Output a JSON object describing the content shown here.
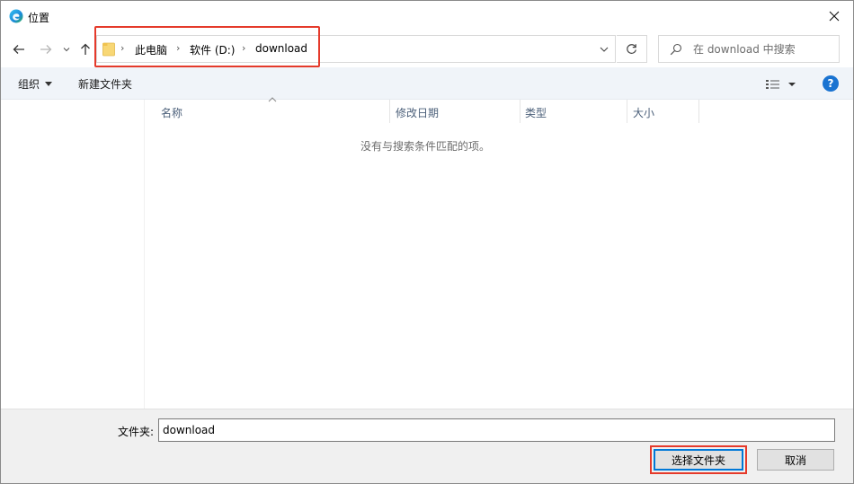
{
  "window": {
    "title": "位置",
    "app_icon": "edge-icon",
    "close_icon": "close-icon"
  },
  "navbar": {
    "back_icon": "arrow-left-icon",
    "forward_icon": "arrow-right-icon",
    "recent_icon": "chevron-down-icon",
    "up_icon": "arrow-up-icon",
    "breadcrumb": [
      "此电脑",
      "软件 (D:)",
      "download"
    ],
    "refresh_icon": "refresh-icon",
    "search_placeholder": "在 download 中搜索",
    "search_icon": "search-icon"
  },
  "toolbar": {
    "organize_label": "组织",
    "new_folder_label": "新建文件夹",
    "view_icon": "details-view-icon",
    "help_label": "?"
  },
  "file_list": {
    "columns": [
      "名称",
      "修改日期",
      "类型",
      "大小"
    ],
    "empty_message": "没有与搜索条件匹配的项。"
  },
  "footer": {
    "folder_label": "文件夹:",
    "folder_value": "download",
    "select_button": "选择文件夹",
    "cancel_button": "取消"
  },
  "colors": {
    "highlight_red": "#e53a2b",
    "accent_blue": "#0078d7",
    "help_blue": "#1a73d1",
    "folder_yellow": "#f8d775"
  }
}
